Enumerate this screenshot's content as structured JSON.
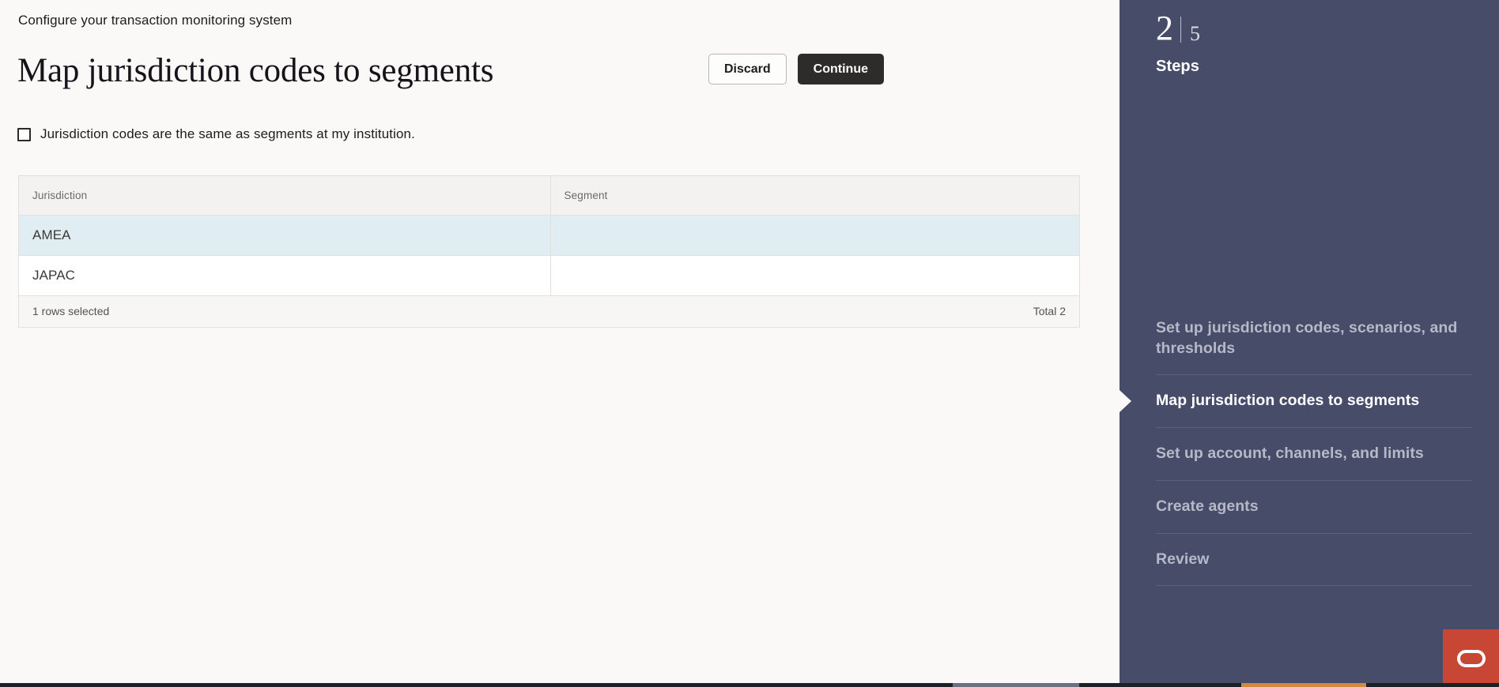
{
  "header": {
    "eyebrow": "Configure your transaction monitoring system",
    "title": "Map jurisdiction codes to segments",
    "discard_label": "Discard",
    "continue_label": "Continue"
  },
  "options": {
    "same_as_segments_label": "Jurisdiction codes are the same as segments at my institution.",
    "same_as_segments_checked": false
  },
  "table": {
    "columns": [
      "Jurisdiction",
      "Segment"
    ],
    "rows": [
      {
        "jurisdiction": "AMEA",
        "segment": "",
        "selected": true
      },
      {
        "jurisdiction": "JAPAC",
        "segment": "",
        "selected": false
      }
    ],
    "footer_left": "1 rows selected",
    "footer_right": "Total 2"
  },
  "sidebar": {
    "current_step": "2",
    "total_steps": "5",
    "steps_label": "Steps",
    "items": [
      {
        "label": "Set up jurisdiction codes, scenarios, and thresholds",
        "active": false
      },
      {
        "label": "Map jurisdiction codes to segments",
        "active": true
      },
      {
        "label": "Set up account, channels, and limits",
        "active": false
      },
      {
        "label": "Create agents",
        "active": false
      },
      {
        "label": "Review",
        "active": false
      }
    ]
  },
  "branding": {
    "logo_name": "oracle-logo",
    "accent_color": "#c74634",
    "sidebar_color": "#474c69"
  }
}
